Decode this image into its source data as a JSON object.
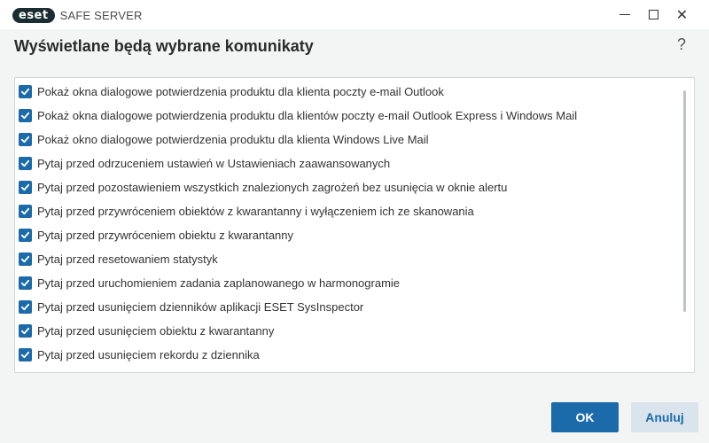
{
  "window": {
    "brand_mark": "eset",
    "app_name": "SAFE SERVER",
    "minimize_icon": "minimize-icon",
    "maximize_icon": "maximize-icon",
    "close_icon": "close-icon",
    "close_glyph": "✕"
  },
  "header": {
    "title": "Wyświetlane będą wybrane komunikaty",
    "help": "?"
  },
  "colors": {
    "accent": "#1b6aaa",
    "background": "#f3f4f4",
    "cancel_bg": "#d9e4ec"
  },
  "items": [
    {
      "label": "Pokaż okna dialogowe potwierdzenia produktu dla klienta poczty e-mail Outlook",
      "checked": true
    },
    {
      "label": "Pokaż okna dialogowe potwierdzenia produktu dla klientów poczty e-mail Outlook Express i Windows Mail",
      "checked": true
    },
    {
      "label": "Pokaż okno dialogowe potwierdzenia produktu dla klienta Windows Live Mail",
      "checked": true
    },
    {
      "label": "Pytaj przed odrzuceniem ustawień w Ustawieniach zaawansowanych",
      "checked": true
    },
    {
      "label": "Pytaj przed pozostawieniem wszystkich znalezionych zagrożeń bez usunięcia w oknie alertu",
      "checked": true
    },
    {
      "label": "Pytaj przed przywróceniem obiektów z kwarantanny i wyłączeniem ich ze skanowania",
      "checked": true
    },
    {
      "label": "Pytaj przed przywróceniem obiektu z kwarantanny",
      "checked": true
    },
    {
      "label": "Pytaj przed resetowaniem statystyk",
      "checked": true
    },
    {
      "label": "Pytaj przed uruchomieniem zadania zaplanowanego w harmonogramie",
      "checked": true
    },
    {
      "label": "Pytaj przed usunięciem dzienników aplikacji ESET SysInspector",
      "checked": true
    },
    {
      "label": "Pytaj przed usunięciem obiektu z kwarantanny",
      "checked": true
    },
    {
      "label": "Pytaj przed usunięciem rekordu z dziennika",
      "checked": true
    },
    {
      "label": "",
      "checked": true
    }
  ],
  "footer": {
    "ok_label": "OK",
    "cancel_label": "Anuluj"
  }
}
